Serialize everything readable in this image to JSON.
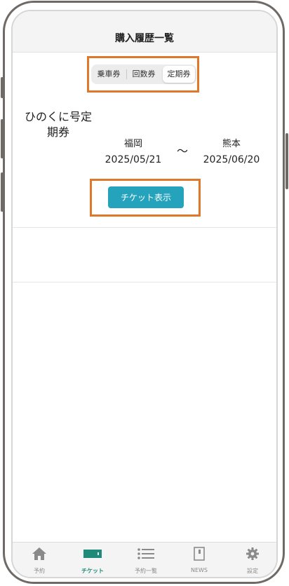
{
  "header": {
    "title": "購入履歴一覧"
  },
  "segments": [
    {
      "label": "乗車券",
      "active": false
    },
    {
      "label": "回数券",
      "active": false
    },
    {
      "label": "定期券",
      "active": true
    }
  ],
  "ticket": {
    "name_line1": "ひのくに号定",
    "name_line2": "期券",
    "from_station": "福岡",
    "to_station": "熊本",
    "tilde": "～",
    "start_date": "2025/05/21",
    "end_date": "2025/06/20",
    "show_button": "チケット表示"
  },
  "tabbar": {
    "items": [
      {
        "label": "予約",
        "icon": "home-icon",
        "active": false
      },
      {
        "label": "チケット",
        "icon": "ticket-icon",
        "active": true
      },
      {
        "label": "予約一覧",
        "icon": "list-icon",
        "active": false
      },
      {
        "label": "NEWS",
        "icon": "news-icon",
        "active": false
      },
      {
        "label": "設定",
        "icon": "gear-icon",
        "active": false
      }
    ]
  },
  "colors": {
    "accent_button": "#26a3bc",
    "highlight": "#e0782c",
    "tab_active": "#1f8a7a"
  }
}
